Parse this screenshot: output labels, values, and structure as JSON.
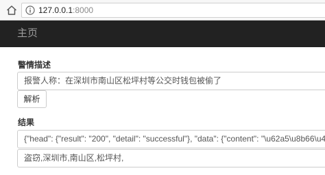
{
  "browser": {
    "url_host": "127.0.0.1",
    "url_port": ":8000"
  },
  "navbar": {
    "brand": "主页"
  },
  "form": {
    "description_label": "警情描述",
    "description_value": "报警人称：在深圳市南山区松坪村等公交时钱包被偷了",
    "parse_button_label": "解析",
    "result_label": "结果",
    "result_json": "{\"head\": {\"result\": \"200\", \"detail\": \"successful\"}, \"data\": {\"content\": \"\\u62a5\\u8b66\\u4eba\\u79f0",
    "result_summary": "盗窃,深圳市,南山区,松坪村,"
  }
}
